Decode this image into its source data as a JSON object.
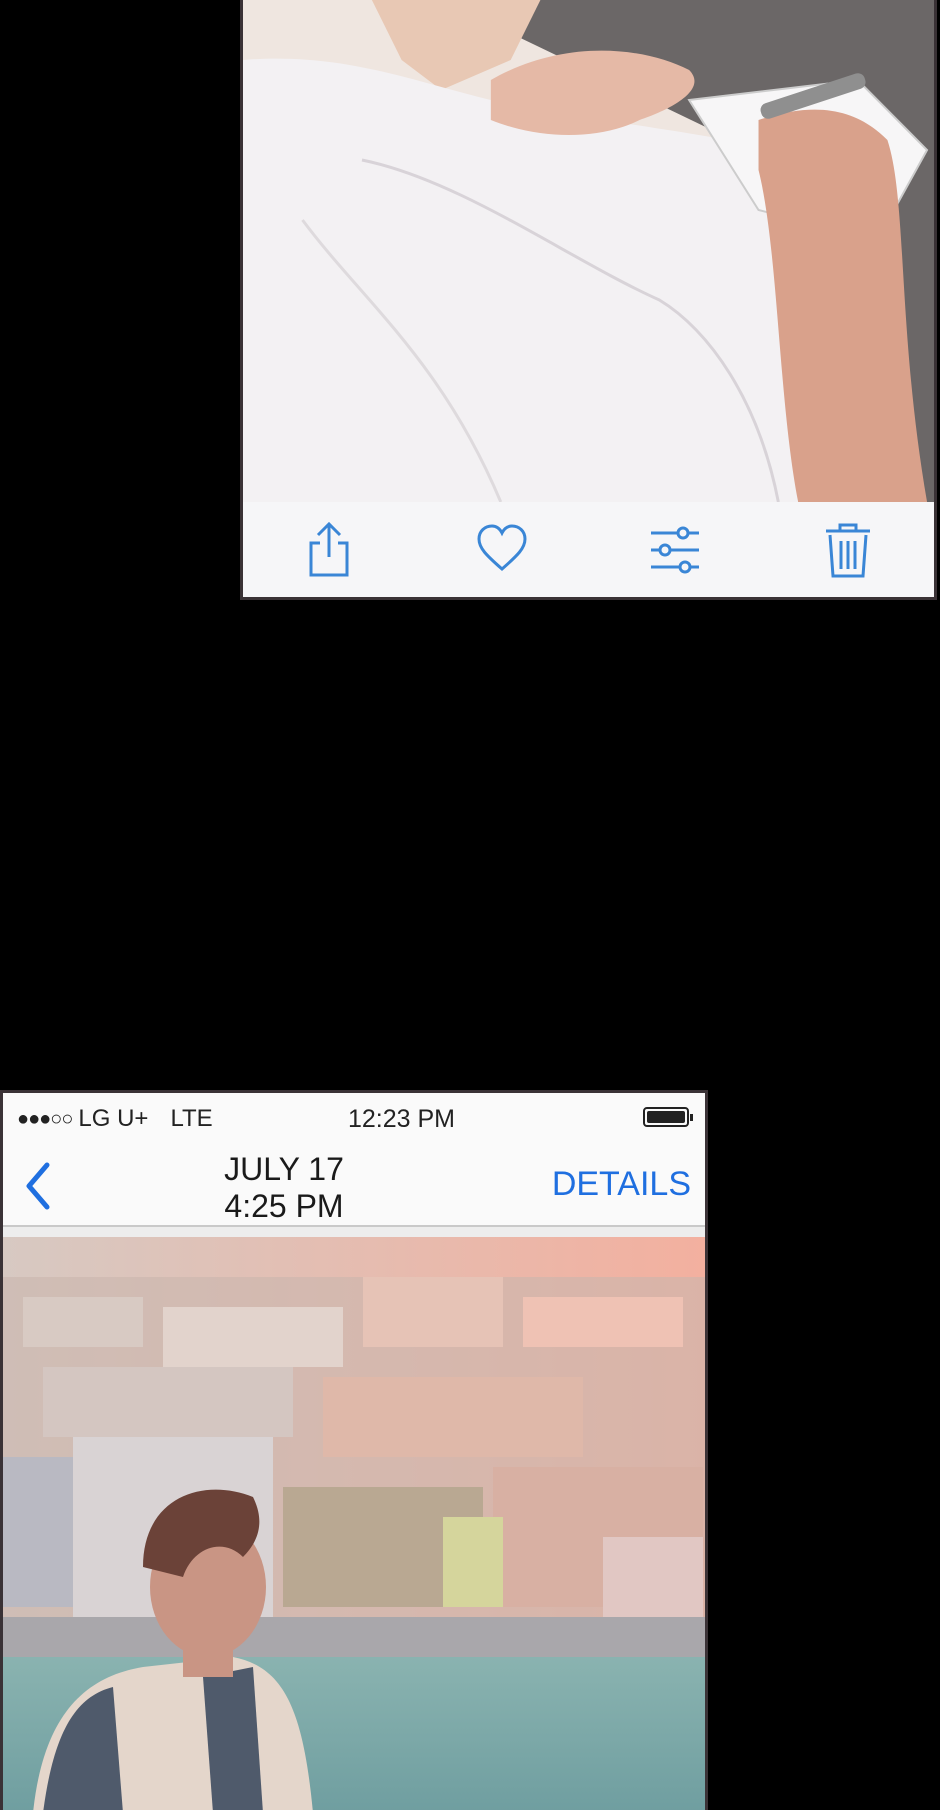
{
  "top_panel": {
    "toolbar": {
      "share_icon": "share-icon",
      "favorite_icon": "heart-icon",
      "edit_icon": "sliders-icon",
      "delete_icon": "trash-icon"
    }
  },
  "bottom_panel": {
    "status_bar": {
      "signal": "●●●○○",
      "carrier": "LG U+",
      "network": "LTE",
      "time": "12:23 PM"
    },
    "nav": {
      "back_icon": "chevron-left-icon",
      "date": "JULY 17",
      "time": "4:25 PM",
      "details_label": "DETAILS"
    }
  },
  "colors": {
    "accent": "#1f6fe0",
    "toolbar_icon": "#3a86d6",
    "frame": "#3a3236"
  }
}
